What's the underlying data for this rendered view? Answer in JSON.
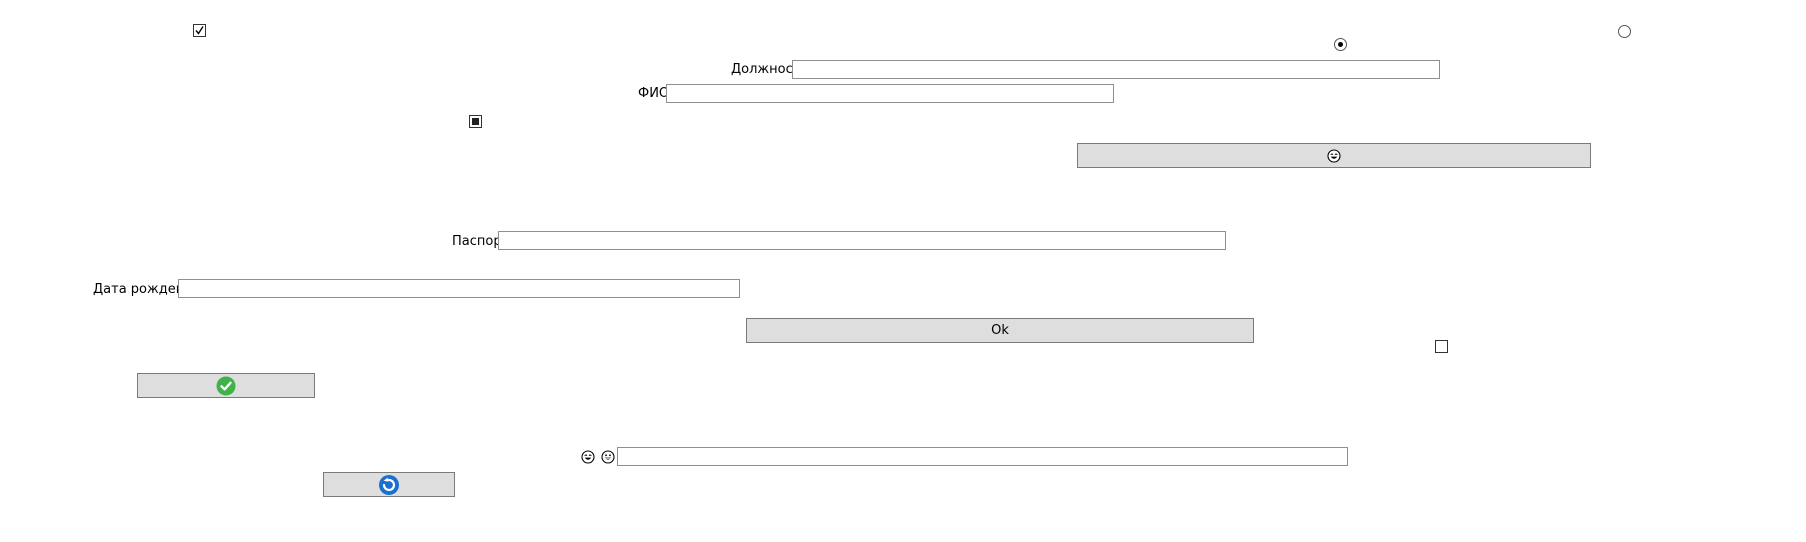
{
  "labels": {
    "position": "Должность",
    "fio": "ФИО",
    "passport": "Паспорт",
    "birth_date": "Дата рождения"
  },
  "inputs": {
    "position": {
      "value": "",
      "placeholder": ""
    },
    "fio": {
      "value": "",
      "placeholder": ""
    },
    "passport": {
      "value": "",
      "placeholder": ""
    },
    "birth_date": {
      "value": "",
      "placeholder": ""
    },
    "bottom": {
      "value": "",
      "placeholder": ""
    }
  },
  "buttons": {
    "ok_label": "Ok",
    "emoji_button_icon": "laughing-face-icon",
    "check_button_icon": "green-check-icon",
    "refresh_button_icon": "refresh-icon"
  },
  "checkboxes": {
    "top_left": {
      "state": "checked"
    },
    "middle": {
      "state": "indeterminate"
    },
    "right": {
      "state": "unchecked"
    }
  },
  "radios": {
    "selected": {
      "state": "selected"
    },
    "unselected": {
      "state": "unselected"
    }
  },
  "icons": {
    "inline_left": "laughing-face-icon",
    "inline_right": "grinning-face-icon"
  },
  "colors": {
    "button_bg": "#dedede",
    "check_green": "#3fb24a",
    "refresh_blue": "#1a6fd0"
  }
}
